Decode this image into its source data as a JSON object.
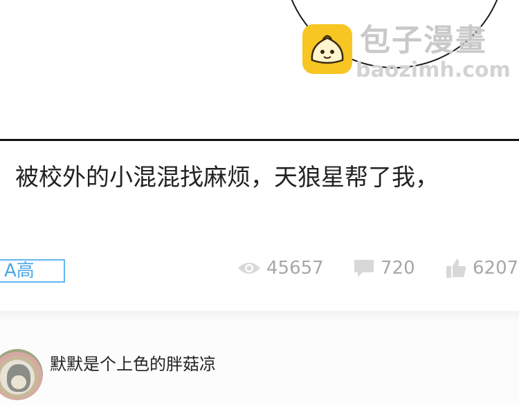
{
  "watermark": {
    "site_name": "包子漫畫",
    "url": "baozimh.com",
    "logo_icon": "bun-logo-icon",
    "colors": {
      "logo_bg": "#f7c623",
      "text": "#c9c9c9"
    }
  },
  "post": {
    "text": "被校外的小混混找麻烦，天狼星帮了我，"
  },
  "meta": {
    "tag": "A高",
    "views": "45657",
    "comments": "720",
    "likes": "6207",
    "icons": [
      "eye-icon",
      "comment-icon",
      "thumbs-up-icon"
    ]
  },
  "comment": {
    "username": "默默是个上色的胖菇凉",
    "avatar_icon": "avatar"
  },
  "colors": {
    "accent_blue": "#4aa7e6",
    "stat_gray": "#a7a7a7",
    "text": "#222222"
  }
}
